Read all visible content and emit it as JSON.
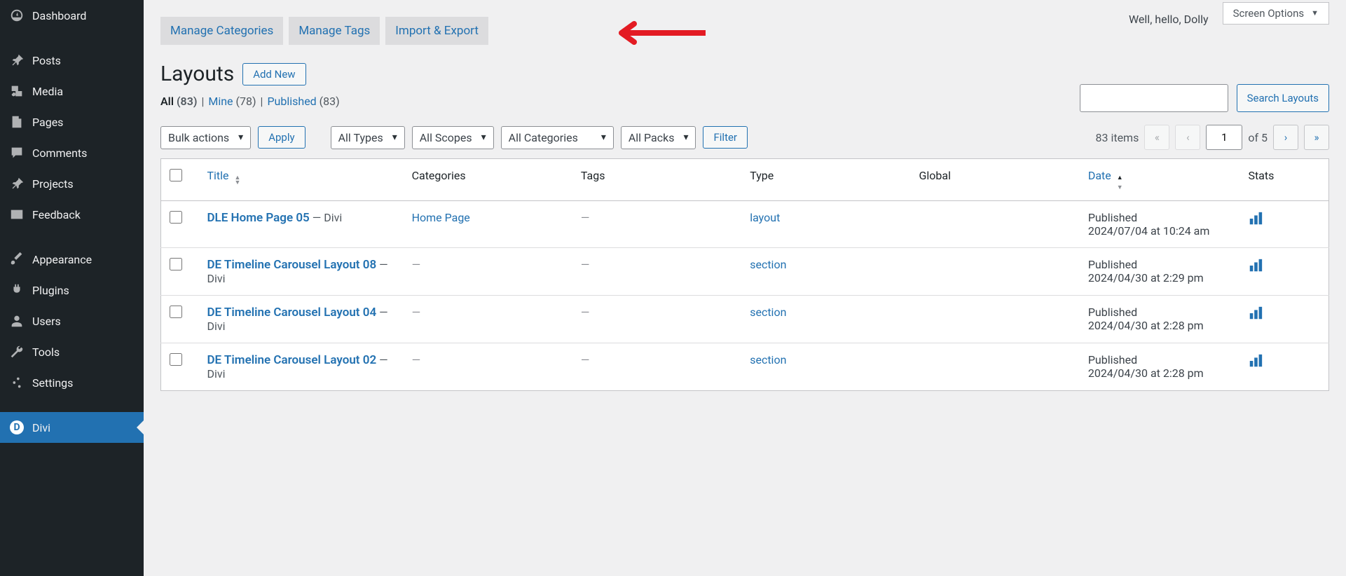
{
  "hello_text": "Well, hello, Dolly",
  "screen_options": "Screen Options",
  "sidebar": {
    "items": [
      {
        "label": "Dashboard"
      },
      {
        "label": "Posts"
      },
      {
        "label": "Media"
      },
      {
        "label": "Pages"
      },
      {
        "label": "Comments"
      },
      {
        "label": "Projects"
      },
      {
        "label": "Feedback"
      },
      {
        "label": "Appearance"
      },
      {
        "label": "Plugins"
      },
      {
        "label": "Users"
      },
      {
        "label": "Tools"
      },
      {
        "label": "Settings"
      },
      {
        "label": "Divi"
      }
    ]
  },
  "subtabs": [
    "Manage Categories",
    "Manage Tags",
    "Import & Export"
  ],
  "page_title": "Layouts",
  "add_new": "Add New",
  "filters": {
    "all": "All",
    "all_count": "(83)",
    "mine": "Mine",
    "mine_count": "(78)",
    "published": "Published",
    "published_count": "(83)"
  },
  "bulk": "Bulk actions",
  "apply": "Apply",
  "dd_types": "All Types",
  "dd_scopes": "All Scopes",
  "dd_cats": "All Categories",
  "dd_packs": "All Packs",
  "filter_btn": "Filter",
  "items_count": "83 items",
  "page_value": "1",
  "of_pages": "of 5",
  "search_btn": "Search Layouts",
  "cols": {
    "title": "Title",
    "cats": "Categories",
    "tags": "Tags",
    "type": "Type",
    "global": "Global",
    "date": "Date",
    "stats": "Stats"
  },
  "rows": [
    {
      "title": "DLE Home Page 05",
      "author": "— Divi",
      "cat": "Home Page",
      "tags": "—",
      "type": "layout",
      "date_label": "Published",
      "date": "2024/07/04 at 10:24 am"
    },
    {
      "title": "DE Timeline Carousel Layout 08",
      "author": "— Divi",
      "cat": "—",
      "tags": "—",
      "type": "section",
      "date_label": "Published",
      "date": "2024/04/30 at 2:29 pm"
    },
    {
      "title": "DE Timeline Carousel Layout 04",
      "author": "— Divi",
      "cat": "—",
      "tags": "—",
      "type": "section",
      "date_label": "Published",
      "date": "2024/04/30 at 2:28 pm"
    },
    {
      "title": "DE Timeline Carousel Layout 02",
      "author": "— Divi",
      "cat": "—",
      "tags": "—",
      "type": "section",
      "date_label": "Published",
      "date": "2024/04/30 at 2:28 pm"
    }
  ]
}
